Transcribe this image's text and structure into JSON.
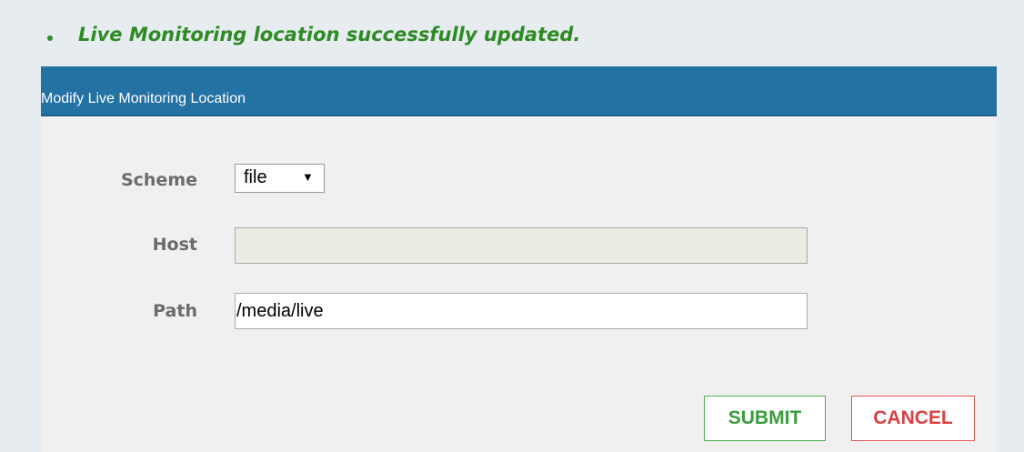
{
  "flash": {
    "message": "Live Monitoring location successfully updated."
  },
  "panel": {
    "title": "Modify Live Monitoring Location"
  },
  "form": {
    "scheme_label": "Scheme",
    "scheme_value": "file",
    "host_label": "Host",
    "host_value": "",
    "path_label": "Path",
    "path_value": "/media/live"
  },
  "buttons": {
    "submit": "SUBMIT",
    "cancel": "CANCEL"
  },
  "colors": {
    "success_text": "#2e8b24",
    "header_bg": "#2472a4",
    "submit_border": "#4caf50",
    "cancel_border": "#e25555"
  }
}
